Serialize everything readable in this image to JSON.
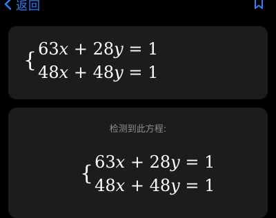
{
  "nav": {
    "back_label": "返回",
    "back_icon": "chevron-left-icon",
    "bookmark_icon": "bookmark-icon",
    "accent_color": "#2f80ff"
  },
  "input_card": {
    "equations": [
      {
        "a": "63",
        "x": "x",
        "op": "+",
        "b": "28",
        "y": "y",
        "eq": "=",
        "c": "1"
      },
      {
        "a": "48",
        "x": "x",
        "op": "+",
        "b": "48",
        "y": "y",
        "eq": "=",
        "c": "1"
      }
    ]
  },
  "result_card": {
    "label": "检测到此方程:",
    "equations": [
      {
        "a": "63",
        "x": "x",
        "op": "+",
        "b": "28",
        "y": "y",
        "eq": "=",
        "c": "1"
      },
      {
        "a": "48",
        "x": "x",
        "op": "+",
        "b": "48",
        "y": "y",
        "eq": "=",
        "c": "1"
      }
    ]
  },
  "colors": {
    "background": "#000000",
    "card": "#1c1c1e",
    "text": "#ffffff",
    "secondary_text": "#8e8e93"
  }
}
